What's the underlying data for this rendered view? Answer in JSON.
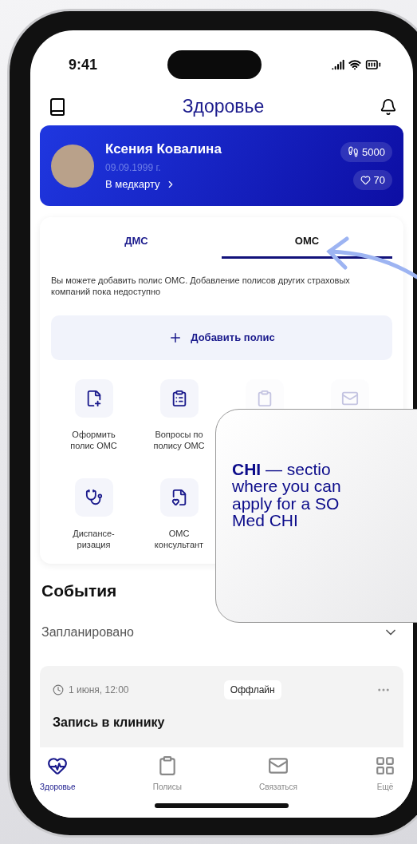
{
  "status_bar": {
    "time": "9:41"
  },
  "header": {
    "title": "Здоровье"
  },
  "profile": {
    "name": "Ксения Ковалина",
    "birth_date": "09.09.1999 г.",
    "link": "В медкарту",
    "steps": "5000",
    "heart": "70"
  },
  "tabs": [
    {
      "label": "ДМС",
      "selected": false
    },
    {
      "label": "ОМС",
      "selected": true
    }
  ],
  "notice": "Вы можете добавить полис ОМС. Добавление полисов других страховых компаний пока недоступно",
  "add_button": {
    "label": "Добавить полис"
  },
  "tiles": [
    {
      "kind": "file-plus",
      "label": "Оформить полис ОМС"
    },
    {
      "kind": "clipboard",
      "label": "Вопросы по полису ОМС"
    },
    {
      "kind": "faded-clipboard"
    },
    {
      "kind": "faded-mail"
    },
    {
      "kind": "stethoscope",
      "label": "Диспансе-ризация"
    },
    {
      "kind": "file-cross",
      "label": "ОМС консультант"
    }
  ],
  "events": {
    "title": "События",
    "filter": "Запланировано",
    "items": [
      {
        "time": "1 июня, 12:00",
        "tag": "Оффлайн",
        "title": "Запись в клинику"
      }
    ]
  },
  "bottom_nav": [
    {
      "kind": "health",
      "label": "Здоровье",
      "selected": true
    },
    {
      "kind": "policies",
      "label": "Полисы",
      "selected": false
    },
    {
      "kind": "contact",
      "label": "Связаться",
      "selected": false
    },
    {
      "kind": "more",
      "label": "Ещё",
      "selected": false
    }
  ],
  "callout": {
    "lines": [
      "**CHI** — sectio",
      "where you can",
      "apply for a SO",
      "Med CHI"
    ]
  }
}
